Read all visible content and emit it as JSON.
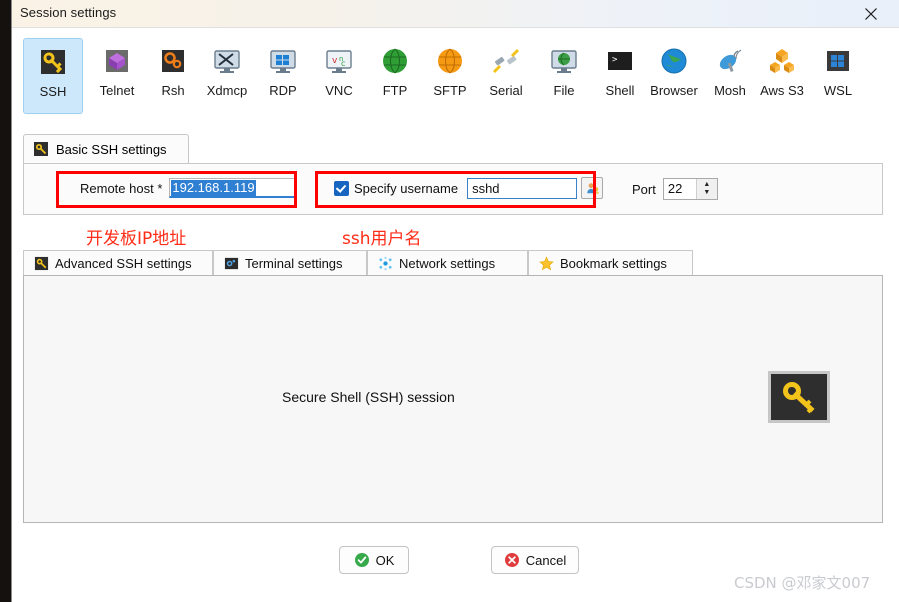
{
  "window": {
    "title": "Session settings",
    "close_icon": "close-icon"
  },
  "protocols": [
    {
      "label": "SSH",
      "icon": "key-icon",
      "selected": true
    },
    {
      "label": "Telnet",
      "icon": "purple-cube-icon",
      "selected": false
    },
    {
      "label": "Rsh",
      "icon": "orange-gears-icon",
      "selected": false
    },
    {
      "label": "Xdmcp",
      "icon": "monitor-x-icon",
      "selected": false
    },
    {
      "label": "RDP",
      "icon": "windows-monitor-icon",
      "selected": false
    },
    {
      "label": "VNC",
      "icon": "vnc-monitor-icon",
      "selected": false
    },
    {
      "label": "FTP",
      "icon": "green-globe-icon",
      "selected": false
    },
    {
      "label": "SFTP",
      "icon": "orange-globe-icon",
      "selected": false
    },
    {
      "label": "Serial",
      "icon": "serial-plug-icon",
      "selected": false
    },
    {
      "label": "File",
      "icon": "file-monitor-icon",
      "selected": false
    },
    {
      "label": "Shell",
      "icon": "terminal-icon",
      "selected": false
    },
    {
      "label": "Browser",
      "icon": "blue-globe-icon",
      "selected": false
    },
    {
      "label": "Mosh",
      "icon": "satellite-dish-icon",
      "selected": false
    },
    {
      "label": "Aws S3",
      "icon": "aws-cubes-icon",
      "selected": false
    },
    {
      "label": "WSL",
      "icon": "windows-logo-icon",
      "selected": false
    }
  ],
  "basic_tab": {
    "label": "Basic SSH settings",
    "icon": "key-icon"
  },
  "form": {
    "remote_host_label": "Remote host *",
    "remote_host_value": "192.168.1.119",
    "specify_username_label": "Specify username",
    "specify_username_checked": true,
    "username_value": "sshd",
    "username_picker_icon": "user-picker-icon",
    "port_label": "Port",
    "port_value": "22",
    "spin_up_icon": "spin-up-icon",
    "spin_down_icon": "spin-down-icon"
  },
  "annotations": {
    "host_note": "开发板IP地址",
    "username_note": "ssh用户名",
    "box_color": "#ff0000",
    "text_color": "#ff2d17"
  },
  "subtabs": [
    {
      "label": "Advanced SSH settings",
      "icon": "key-icon"
    },
    {
      "label": "Terminal settings",
      "icon": "terminal-gear-icon"
    },
    {
      "label": "Network settings",
      "icon": "network-nodes-icon"
    },
    {
      "label": "Bookmark settings",
      "icon": "star-icon"
    }
  ],
  "content": {
    "caption": "Secure Shell (SSH) session",
    "icon": "key-icon"
  },
  "footer": {
    "ok_label": "OK",
    "ok_icon": "check-circle-icon",
    "cancel_label": "Cancel",
    "cancel_icon": "x-circle-icon"
  },
  "watermark": "CSDN @邓家文007"
}
